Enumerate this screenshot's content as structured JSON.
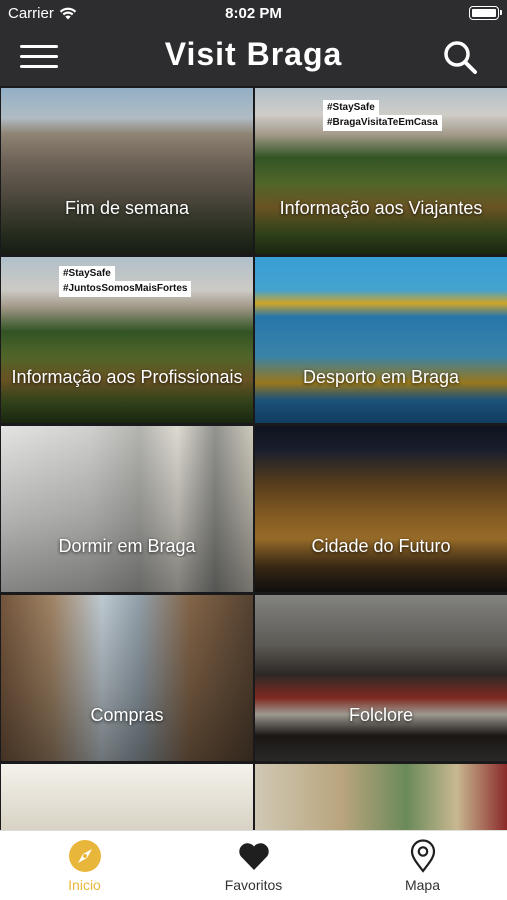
{
  "status_bar": {
    "carrier": "Carrier",
    "time": "8:02 PM"
  },
  "header": {
    "title": "Visit Braga"
  },
  "tiles": [
    {
      "label": "Fim de semana",
      "tags": []
    },
    {
      "label": "Informação aos Viajantes",
      "tags": [
        "#StaySafe",
        "#BragaVisitaTeEmCasa"
      ]
    },
    {
      "label": "Informação aos Profissionais",
      "tags": [
        "#StaySafe",
        "#JuntosSomosMaisFortes"
      ]
    },
    {
      "label": "Desporto em Braga",
      "tags": []
    },
    {
      "label": "Dormir em Braga",
      "tags": []
    },
    {
      "label": "Cidade do Futuro",
      "tags": []
    },
    {
      "label": "Compras",
      "tags": []
    },
    {
      "label": "Folclore",
      "tags": []
    }
  ],
  "tab_bar": {
    "items": [
      {
        "label": "Inicio",
        "icon": "compass-icon",
        "active": true
      },
      {
        "label": "Favoritos",
        "icon": "heart-icon",
        "active": false
      },
      {
        "label": "Mapa",
        "icon": "map-pin-icon",
        "active": false
      }
    ]
  },
  "colors": {
    "accent": "#e8b63a",
    "header_bg": "#2d2d30",
    "tab_bar_bg": "#ffffff"
  }
}
